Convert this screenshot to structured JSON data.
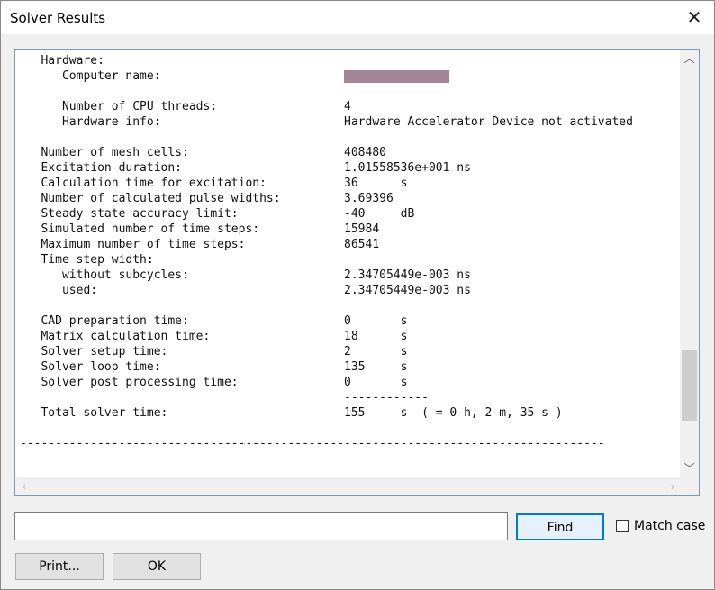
{
  "window": {
    "title": "Solver Results",
    "close_glyph": "✕"
  },
  "log": {
    "hardware_header": "   Hardware:",
    "computer_name_label": "      Computer name:                          ",
    "blank1": " ",
    "cpu_threads": "      Number of CPU threads:                  4",
    "hardware_info": "      Hardware info:                          Hardware Accelerator Device not activated",
    "blank2": " ",
    "mesh_cells": "   Number of mesh cells:                      408480",
    "excitation_duration": "   Excitation duration:                       1.01558536e+001 ns",
    "calc_time_excitation": "   Calculation time for excitation:           36      s",
    "pulse_widths": "   Number of calculated pulse widths:         3.69396",
    "steady_state": "   Steady state accuracy limit:               -40     dB",
    "simulated_steps": "   Simulated number of time steps:            15984",
    "max_steps": "   Maximum number of time steps:              86541",
    "time_step_width": "   Time step width:",
    "without_subcycles": "      without subcycles:                      2.34705449e-003 ns",
    "used": "      used:                                   2.34705449e-003 ns",
    "blank3": " ",
    "cad_prep": "   CAD preparation time:                      0       s",
    "matrix_calc": "   Matrix calculation time:                   18      s",
    "solver_setup": "   Solver setup time:                         2       s",
    "solver_loop": "   Solver loop time:                          135     s",
    "solver_post": "   Solver post processing time:               0       s",
    "separator_short": "                                              ------------",
    "total_time": "   Total solver time:                         155     s  ( = 0 h, 2 m, 35 s )",
    "blank4": " ",
    "separator_long": "-----------------------------------------------------------------------------------"
  },
  "scroll": {
    "up": "︿",
    "down": "﹀",
    "left": "‹",
    "right": "›"
  },
  "find": {
    "input_value": "",
    "button_label": "Find",
    "match_case_label": "Match case",
    "match_case_checked": false
  },
  "footer": {
    "print_label": "Print...",
    "ok_label": "OK"
  }
}
